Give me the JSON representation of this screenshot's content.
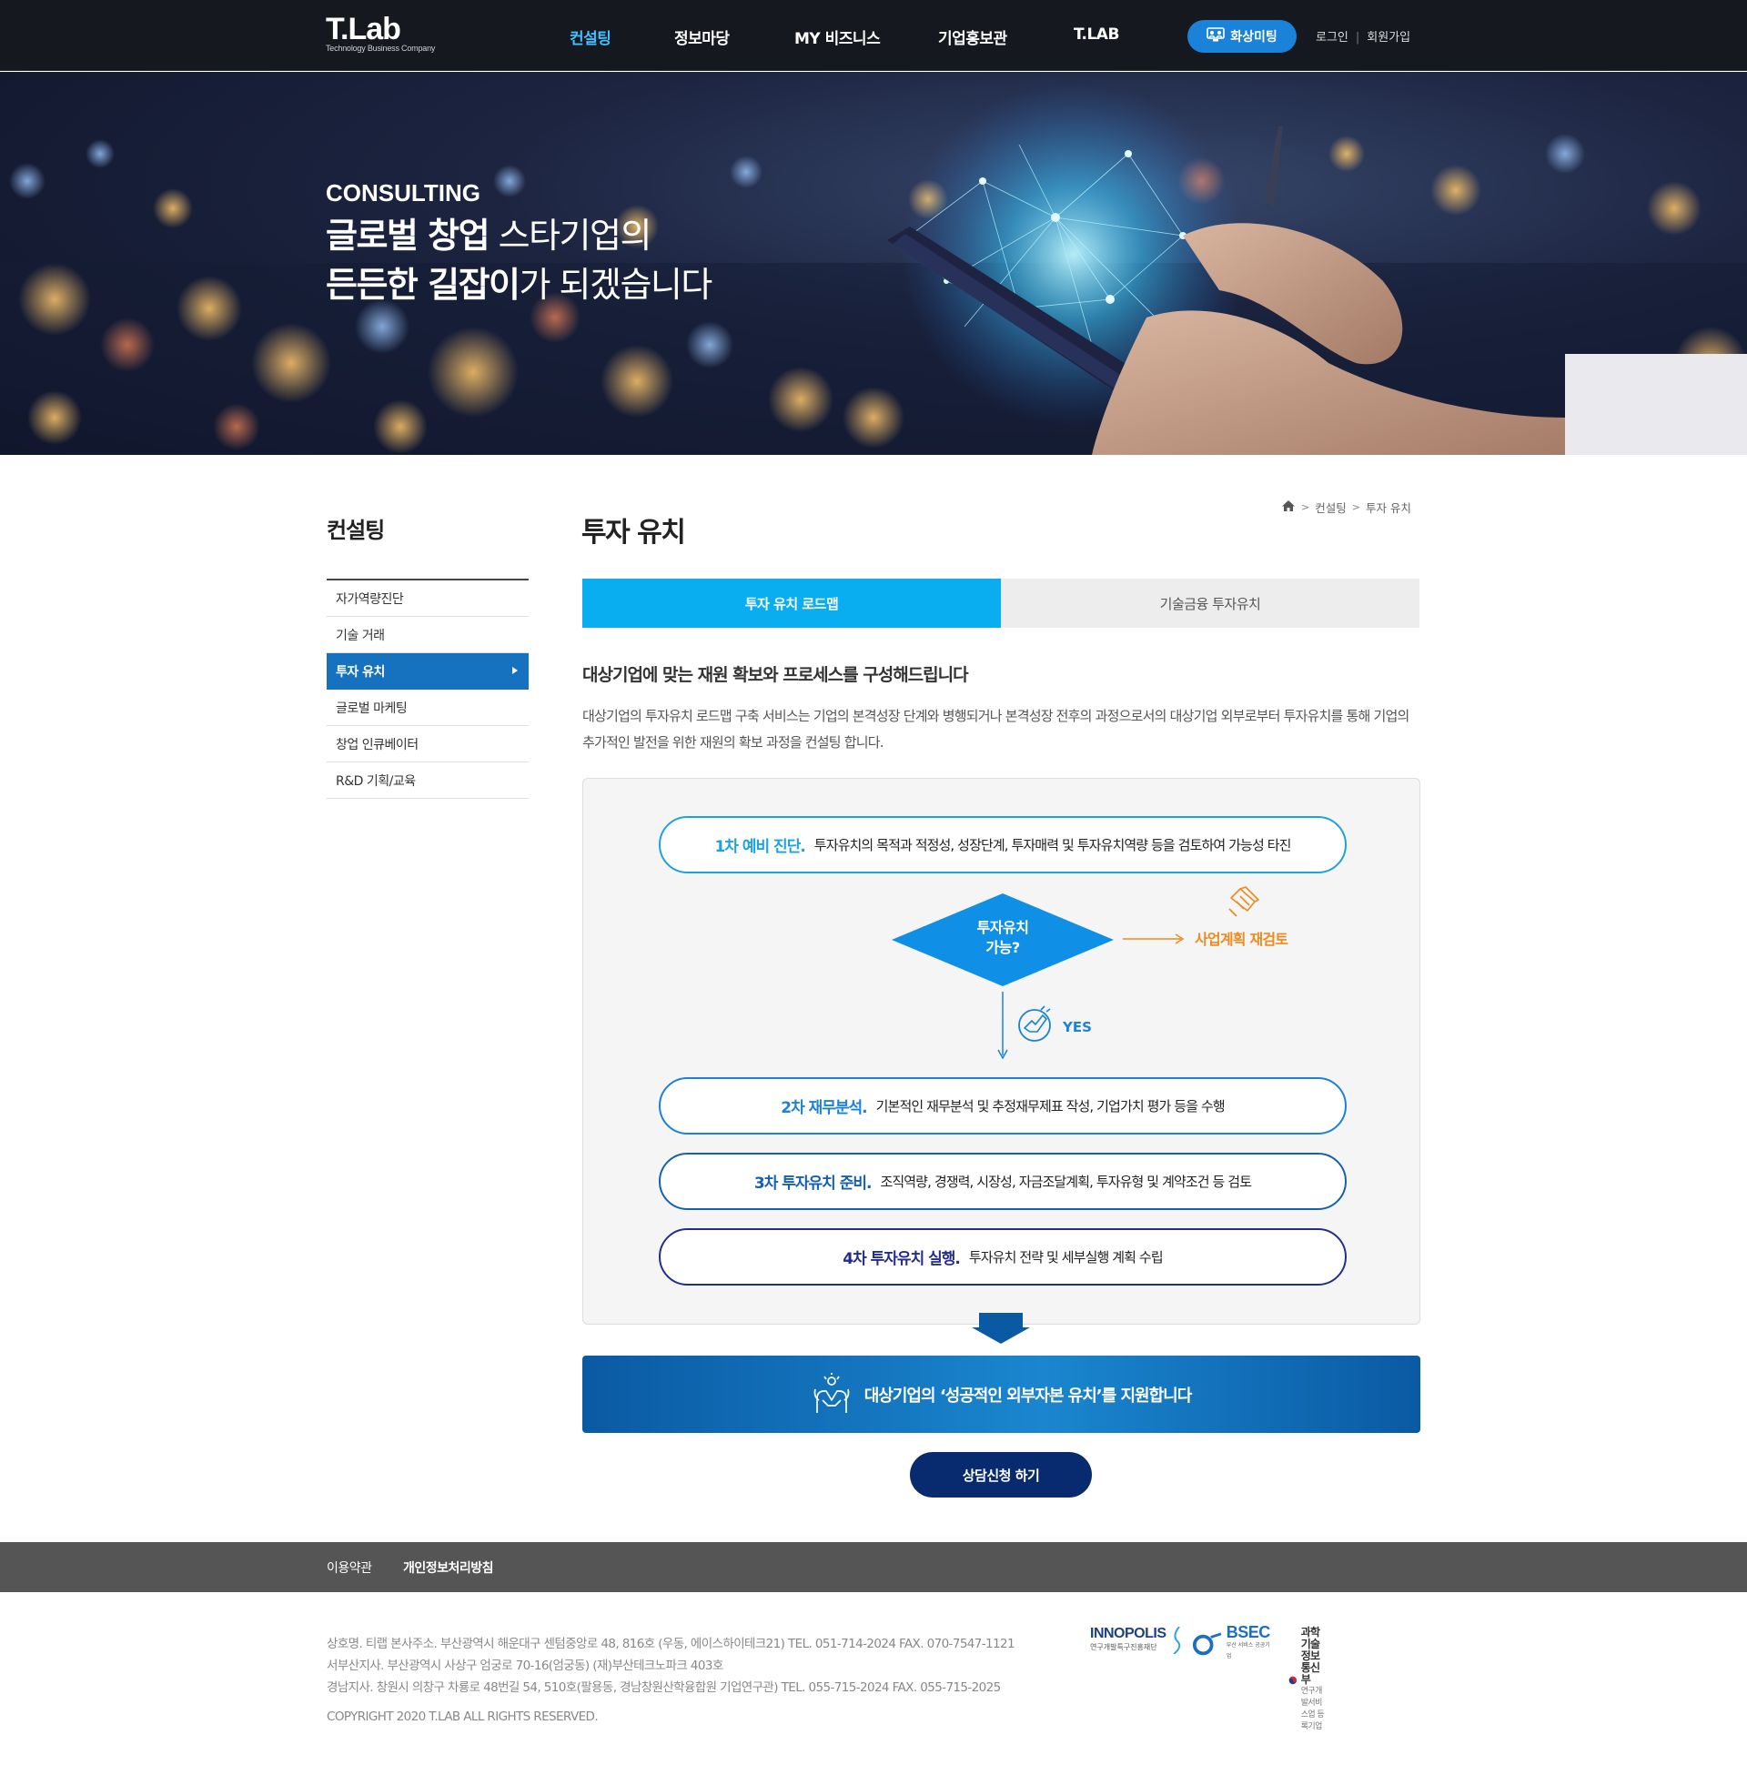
{
  "header": {
    "logo": {
      "main": "T.Lab",
      "sub": "Technology Business Company"
    },
    "nav": [
      "컨설팅",
      "정보마당",
      "MY 비즈니스",
      "기업홍보관",
      "T.LAB"
    ],
    "video_meeting": "화상미팅",
    "login": "로그인",
    "signup": "회원가입"
  },
  "hero": {
    "eyebrow": "CONSULTING",
    "line1_bold": "글로벌 창업",
    "line1_rest": " 스타기업의",
    "line2_bold1": "든든한 ",
    "line2_bold2": "길잡이",
    "line2_rest": "가 되겠습니다"
  },
  "sidebar": {
    "title": "컨설팅",
    "items": [
      {
        "label": "자가역량진단"
      },
      {
        "label": "기술 거래"
      },
      {
        "label": "투자 유치"
      },
      {
        "label": "글로벌 마케팅"
      },
      {
        "label": "창업 인큐베이터"
      },
      {
        "label": "R&D 기획/교육"
      }
    ],
    "active_index": 2
  },
  "content": {
    "title": "투자 유치",
    "breadcrumb": [
      "컨설팅",
      "투자 유치"
    ],
    "tabs": [
      "투자 유치 로드맵",
      "기술금융 투자유치"
    ],
    "heading": "대상기업에 맞는 재원 확보와 프로세스를 구성해드립니다",
    "description": "대상기업의 투자유치 로드맵 구축 서비스는 기업의 본격성장 단계와 병행되거나 본격성장 전후의 과정으로서의 대상기업 외부로부터 투자유치를 통해 기업의 추가적인 발전을 위한 재원의 확보 과정을 컨설팅 합니다."
  },
  "flow": {
    "steps": [
      {
        "label": "1차 예비 진단.",
        "desc": "투자유치의 목적과 적정성, 성장단계, 투자매력 및 투자유치역량 등을 검토하여 가능성 타진",
        "color": "#1aa3e0"
      },
      {
        "label": "2차 재무분석.",
        "desc": "기본적인 재무분석 및 추정재무제표 작성, 기업가치 평가 등을 수행",
        "color": "#1a82d8"
      },
      {
        "label": "3차 투자유치 준비.",
        "desc": "조직역량, 경쟁력, 시장성, 자금조달계획, 투자유형 및 계약조건 등 검토",
        "color": "#1560b4"
      },
      {
        "label": "4차 투자유치 실행.",
        "desc": "투자유치 전략 및 세부실행 계획 수립",
        "color": "#232d8f"
      }
    ],
    "decision_line1": "투자유치",
    "decision_line2": "가능?",
    "no_action": "사업계획 재검토",
    "yes": "YES",
    "colors": {
      "decision": "#0f8fe5",
      "no": "#f08a1e"
    }
  },
  "result": "대상기업의 ‘성공적인 외부자본 유치’를 지원합니다",
  "cta": "상담신청 하기",
  "footer": {
    "links": [
      "이용약관",
      "개인정보처리방침"
    ],
    "info": [
      "상호명. 티랩   본사주소. 부산광역시 해운대구 센텀중앙로 48, 816호 (우동, 에이스하이테크21)   TEL. 051-714-2024   FAX. 070-7547-1121",
      "서부산지사. 부산광역시 사상구 엄궁로 70-16(엄궁동) (재)부산테크노파크 403호",
      "경남지사. 창원시 의창구 차룡로 48번길 54, 510호(팔용동, 경남창원산학융합원 기업연구관)   TEL. 055-715-2024   FAX. 055-715-2025"
    ],
    "copyright": "COPYRIGHT 2020 T.LAB ALL RIGHTS RESERVED.",
    "partners": [
      {
        "name": "INNOPOLIS",
        "sub": "연구개발특구진흥재단"
      },
      {
        "name": "BSEC",
        "sub": "부산 서비스 공공기업"
      },
      {
        "name": "과학기술정보통신부",
        "sub": "연구개발서비스업 등록기업"
      }
    ]
  }
}
